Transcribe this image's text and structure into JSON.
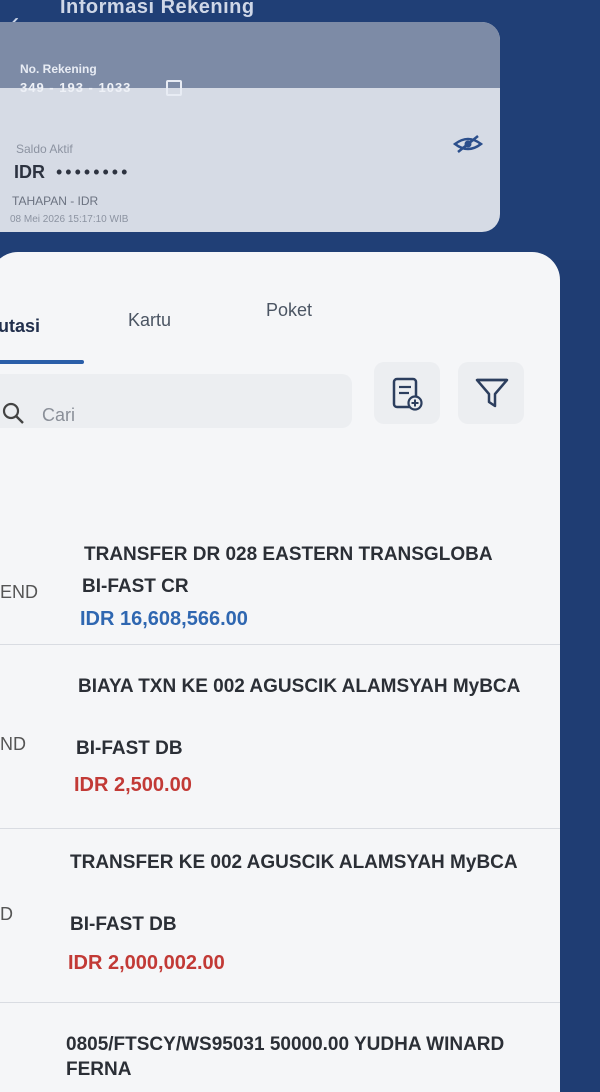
{
  "header": {
    "title": "Informasi Rekening",
    "back_icon": "chevron-left-icon"
  },
  "account": {
    "number_label": "No. Rekening",
    "number": "349 - 193 - 1033",
    "balance_label": "Saldo Aktif",
    "currency": "IDR",
    "balance_masked": "••••••••",
    "product": "TAHAPAN - IDR",
    "updated_at": "08 Mei 2026 15:17:10 WIB"
  },
  "tabs": [
    "utasi",
    "Kartu",
    "Poket"
  ],
  "search": {
    "placeholder": "Cari"
  },
  "transactions": [
    {
      "status": "END",
      "title": "TRANSFER  DR 028 EASTERN TRANSGLOBA",
      "type": "BI-FAST CR",
      "amount": "IDR 16,608,566.00",
      "direction": "credit"
    },
    {
      "status": "ND",
      "title": "BIAYA TXN  KE 002 AGUSCIK ALAMSYAH MyBCA",
      "type": "BI-FAST DB",
      "amount": "IDR 2,500.00",
      "direction": "debit"
    },
    {
      "status": "D",
      "title": "TRANSFER  KE 002 AGUSCIK ALAMSYAH MyBCA",
      "type": "BI-FAST DB",
      "amount": "IDR 2,000,002.00",
      "direction": "debit"
    },
    {
      "status": "",
      "title": "0805/FTSCY/WS95031 50000.00 YUDHA WINARD FERNA",
      "type": "",
      "amount": "",
      "direction": ""
    }
  ],
  "colors": {
    "header_bg": "#203f76",
    "credit": "#2f67b1",
    "debit": "#c23a36",
    "panel_bg": "#f5f6f8"
  }
}
